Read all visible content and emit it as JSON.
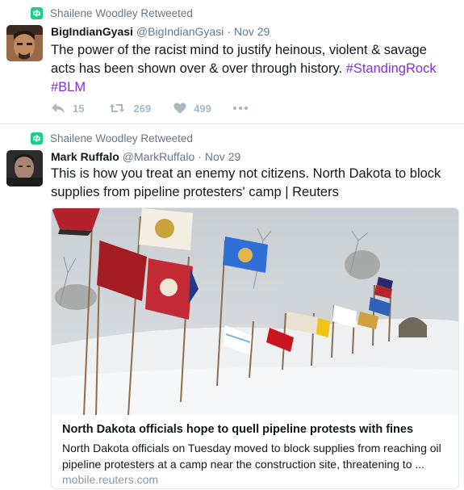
{
  "tweets": [
    {
      "retweeted_by": "Shailene Woodley Retweeted",
      "author_name": "BigIndianGyasi",
      "author_handle": "@BigIndianGyasi",
      "dot": "·",
      "time": "Nov 29",
      "text": "The power of the racist mind to justify heinous, violent & savage acts has been shown over & over through history.",
      "hashtags": [
        "#StandingRock",
        "#BLM"
      ],
      "replies": "15",
      "retweets": "269",
      "likes": "499"
    },
    {
      "retweeted_by": "Shailene Woodley Retweeted",
      "author_name": "Mark Ruffalo",
      "author_handle": "@MarkRuffalo",
      "dot": "·",
      "time": "Nov 29",
      "text": "This is how you treat an enemy not citizens. North Dakota to block supplies from pipeline protesters' camp | Reuters"
    }
  ],
  "card": {
    "title": "North Dakota officials hope to quell pipeline protests with fines",
    "description": "North Dakota officials on Tuesday moved to block supplies from reaching oil pipeline protesters at a camp near the construction site, threatening to ...",
    "domain": "mobile.reuters.com"
  },
  "colors": {
    "retweet_green": "#19cf86",
    "hashtag": "#8a2be2",
    "muted": "#657786",
    "action_gray": "#aab8c2"
  },
  "icons": [
    "retweet-icon",
    "reply-icon",
    "like-icon",
    "more-icon"
  ]
}
